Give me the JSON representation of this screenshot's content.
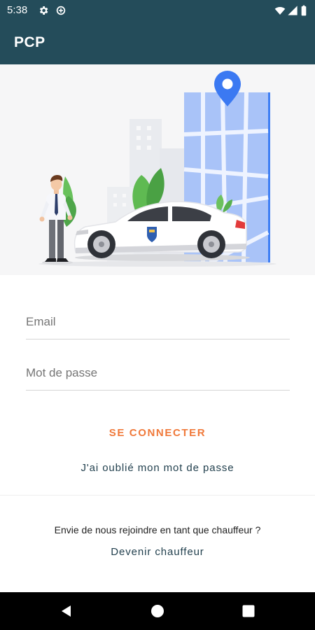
{
  "status_bar": {
    "time": "5:38",
    "left_icons": [
      "settings-icon",
      "data-saver-icon"
    ],
    "right_icons": [
      "wifi-icon",
      "signal-icon",
      "battery-icon"
    ]
  },
  "app_bar": {
    "title": "PCP"
  },
  "colors": {
    "primary": "#244c5a",
    "accent": "#f0793a",
    "link": "#22404e",
    "map": "#a9c3f8",
    "pin": "#3b79f2"
  },
  "hero": {
    "illustration": "chauffeur-with-white-car-and-map-pin"
  },
  "form": {
    "email": {
      "placeholder": "Email",
      "value": ""
    },
    "password": {
      "placeholder": "Mot de passe",
      "value": ""
    }
  },
  "actions": {
    "login_label": "SE CONNECTER",
    "forgot_label": "J'ai oublié mon mot de passe"
  },
  "footer": {
    "join_text": "Envie de nous rejoindre en tant que chauffeur ?",
    "become_label": "Devenir chauffeur"
  },
  "nav_bar": {
    "buttons": [
      "back-icon",
      "home-icon",
      "recents-icon"
    ]
  }
}
